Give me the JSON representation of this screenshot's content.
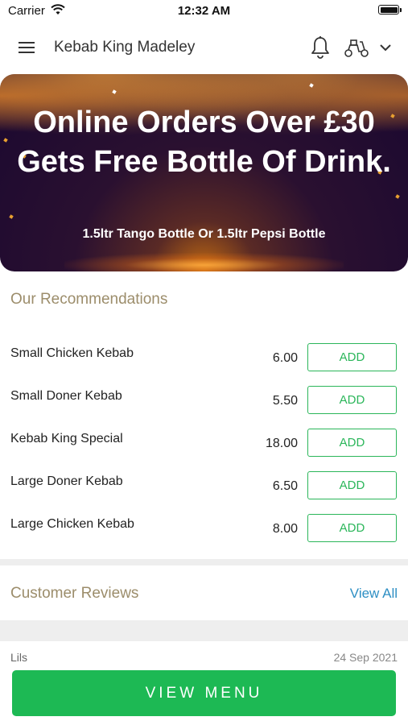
{
  "status_bar": {
    "carrier": "Carrier",
    "time": "12:32 AM"
  },
  "header": {
    "title": "Kebab King Madeley"
  },
  "banner": {
    "headline": "Online Orders Over £30 Gets Free Bottle Of Drink.",
    "subtext": "1.5ltr Tango Bottle Or 1.5ltr Pepsi Bottle"
  },
  "recommendations": {
    "title": "Our Recommendations",
    "add_label": "ADD",
    "items": [
      {
        "name": "Small Chicken Kebab",
        "price": "6.00"
      },
      {
        "name": "Small Doner Kebab",
        "price": "5.50"
      },
      {
        "name": "Kebab King Special",
        "price": "18.00"
      },
      {
        "name": "Large Doner Kebab",
        "price": "6.50"
      },
      {
        "name": "Large Chicken Kebab",
        "price": "8.00"
      }
    ]
  },
  "reviews": {
    "title": "Customer Reviews",
    "view_all": "View All",
    "first": {
      "name": "Lils",
      "date": "24 Sep 2021"
    }
  },
  "footer": {
    "view_menu": "VIEW MENU"
  },
  "colors": {
    "accent_green": "#1db954",
    "section_title": "#9c8d6b",
    "link_blue": "#2e8fc4"
  },
  "icons": {
    "menu": "hamburger-icon",
    "notifications": "bell-icon",
    "delivery": "scooter-icon",
    "expand": "chevron-down-icon"
  }
}
